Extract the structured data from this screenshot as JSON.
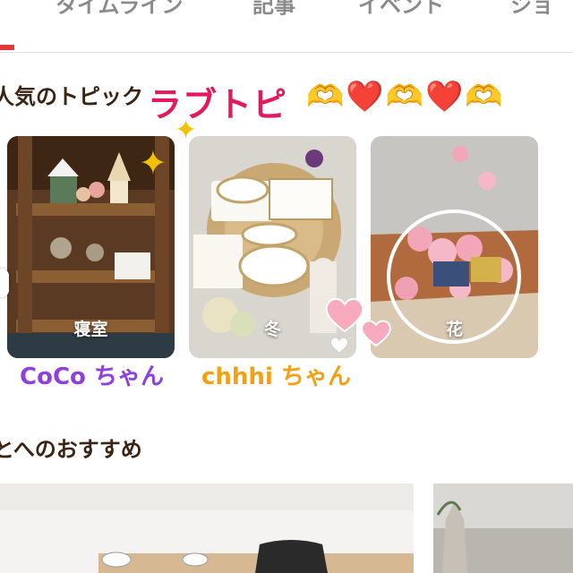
{
  "tabs": [
    "タイムライン",
    "記事",
    "イベント",
    "ショ"
  ],
  "sections": {
    "topics_title": "人気のトピック",
    "recommend_title": "とへのおすすめ"
  },
  "overlay": {
    "love_text": "ラブトピ",
    "emojis": "🫶❤️🫶❤️🫶",
    "user1": "CoCo ちゃん",
    "user2": "chhhi ちゃん"
  },
  "topics": [
    {
      "label": "寝室"
    },
    {
      "label": "冬"
    },
    {
      "label": "花"
    }
  ],
  "colors": {
    "accent": "#e3373b",
    "love_text": "#e6185b",
    "user1": "#8f3fe0",
    "user2": "#f5a012"
  }
}
